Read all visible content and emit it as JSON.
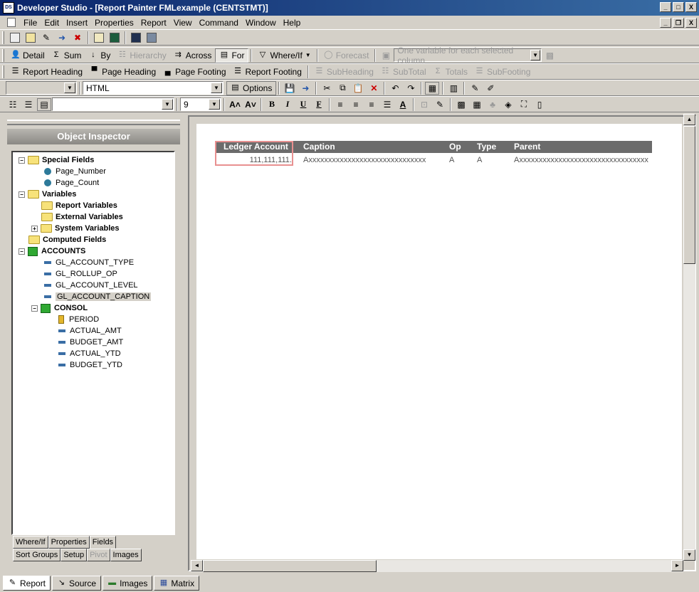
{
  "window": {
    "title": "Developer Studio - [Report Painter FMLexample (CENTSTMT)]",
    "app_icon": "DS",
    "controls": [
      "_",
      "□",
      "X"
    ],
    "mdi_controls": [
      "_",
      "❐",
      "X"
    ]
  },
  "menu": [
    "File",
    "Edit",
    "Insert",
    "Properties",
    "Report",
    "View",
    "Command",
    "Window",
    "Help"
  ],
  "toolbar1": {
    "detail": "Detail",
    "sum": "Sum",
    "by": "By",
    "hierarchy": "Hierarchy",
    "across": "Across",
    "for": "For",
    "where_if": "Where/If",
    "forecast": "Forecast",
    "variable_combo": "One variable for each selected column"
  },
  "toolbar2": {
    "report_heading": "Report Heading",
    "page_heading": "Page Heading",
    "page_footing": "Page Footing",
    "report_footing": "Report Footing",
    "subheading": "SubHeading",
    "subtotal": "SubTotal",
    "totals": "Totals",
    "subfooting": "SubFooting"
  },
  "toolbar3": {
    "format_combo": "HTML",
    "options": "Options"
  },
  "toolbar4": {
    "font_combo": "",
    "size_combo": "9",
    "bold": "B",
    "italic": "I",
    "underline": "U",
    "field": "F"
  },
  "object_inspector": {
    "title": "Object Inspector",
    "tree": {
      "special_fields": "Special Fields",
      "page_number": "Page_Number",
      "page_count": "Page_Count",
      "variables": "Variables",
      "report_variables": "Report Variables",
      "external_variables": "External Variables",
      "system_variables": "System Variables",
      "computed_fields": "Computed Fields",
      "accounts": "ACCOUNTS",
      "gl_account_type": "GL_ACCOUNT_TYPE",
      "gl_rollup_op": "GL_ROLLUP_OP",
      "gl_account_level": "GL_ACCOUNT_LEVEL",
      "gl_account_caption": "GL_ACCOUNT_CAPTION",
      "consol": "CONSOL",
      "period": "PERIOD",
      "actual_amt": "ACTUAL_AMT",
      "budget_amt": "BUDGET_AMT",
      "actual_ytd": "ACTUAL_YTD",
      "budget_ytd": "BUDGET_YTD"
    },
    "tabs_row1": [
      "Where/If",
      "Properties",
      "Fields"
    ],
    "tabs_row2": [
      "Sort Groups",
      "Setup",
      "Pivot",
      "Images"
    ]
  },
  "report": {
    "headers": {
      "ledger": "Ledger Account",
      "caption": "Caption",
      "op": "Op",
      "type": "Type",
      "parent": "Parent"
    },
    "row": {
      "ledger": "111,111,111.",
      "caption": "Axxxxxxxxxxxxxxxxxxxxxxxxxxxxxx",
      "op": "A",
      "type": "A",
      "parent": "Axxxxxxxxxxxxxxxxxxxxxxxxxxxxxxxxx"
    }
  },
  "bottom_tabs": [
    "Report",
    "Source",
    "Images",
    "Matrix"
  ]
}
